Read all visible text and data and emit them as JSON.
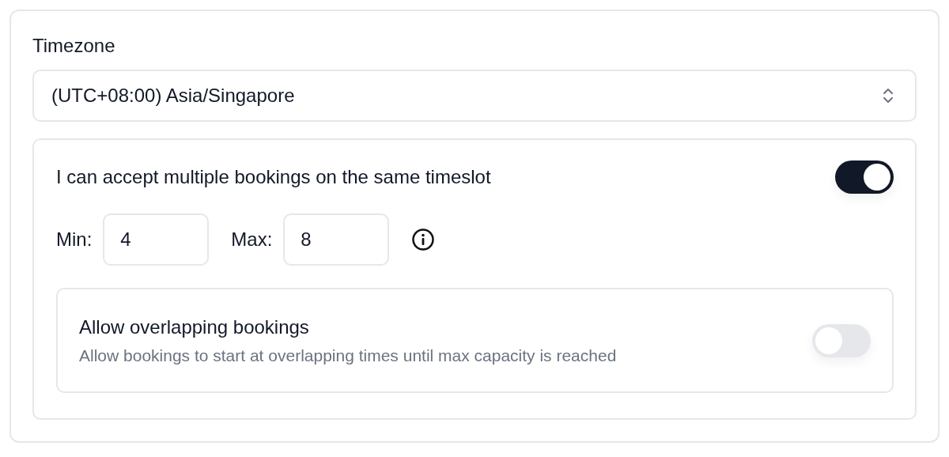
{
  "timezone": {
    "label": "Timezone",
    "value": "(UTC+08:00) Asia/Singapore"
  },
  "multiple_bookings": {
    "label": "I can accept multiple bookings on the same timeslot",
    "on": true,
    "fields": [
      {
        "label": "Min:",
        "value": "4"
      },
      {
        "label": "Max:",
        "value": "8"
      }
    ],
    "overlapping": {
      "title": "Allow overlapping bookings",
      "description": "Allow bookings to start at overlapping times until max capacity is reached",
      "on": false
    }
  }
}
